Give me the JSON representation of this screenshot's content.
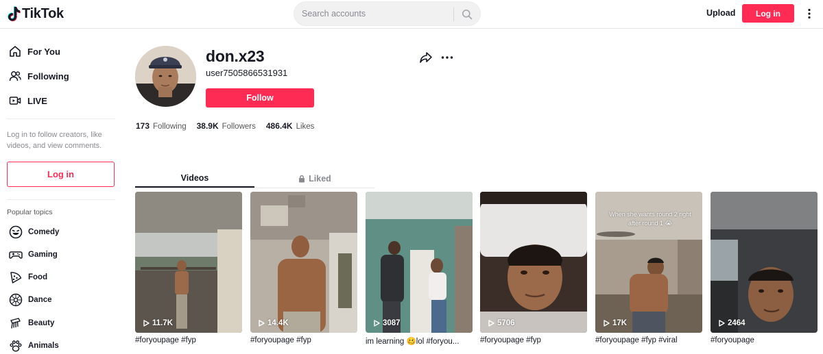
{
  "header": {
    "logo_text": "TikTok",
    "search_placeholder": "Search accounts",
    "upload_label": "Upload",
    "login_label": "Log in",
    "brand_color": "#fe2c55"
  },
  "sidebar": {
    "nav": [
      {
        "label": "For You",
        "icon": "home-icon"
      },
      {
        "label": "Following",
        "icon": "users-icon"
      },
      {
        "label": "LIVE",
        "icon": "live-icon"
      }
    ],
    "login_prompt": "Log in to follow creators, like videos, and view comments.",
    "login_label": "Log in",
    "topics_title": "Popular topics",
    "topics": [
      {
        "label": "Comedy",
        "icon": "comedy-icon"
      },
      {
        "label": "Gaming",
        "icon": "gaming-icon"
      },
      {
        "label": "Food",
        "icon": "food-icon"
      },
      {
        "label": "Dance",
        "icon": "dance-icon"
      },
      {
        "label": "Beauty",
        "icon": "beauty-icon"
      },
      {
        "label": "Animals",
        "icon": "animals-icon"
      }
    ]
  },
  "profile": {
    "username": "don.x23",
    "handle": "user7505866531931",
    "follow_label": "Follow",
    "stats": [
      {
        "value": "173",
        "label": "Following"
      },
      {
        "value": "38.9K",
        "label": "Followers"
      },
      {
        "value": "486.4K",
        "label": "Likes"
      }
    ]
  },
  "tabs": {
    "videos": "Videos",
    "liked": "Liked"
  },
  "videos": [
    {
      "plays": "11.7K",
      "caption": "#foryoupage #fyp",
      "overlay": ""
    },
    {
      "plays": "14.4K",
      "caption": "#foryoupage #fyp",
      "overlay": ""
    },
    {
      "plays": "3087",
      "caption": "im learning 🥴lol #foryou...",
      "overlay": ""
    },
    {
      "plays": "5706",
      "caption": "#foryoupage #fyp",
      "overlay": ""
    },
    {
      "plays": "17K",
      "caption": "#foryoupage #fyp #viral",
      "overlay": "When she wants round 2 right after round 1 😭"
    },
    {
      "plays": "2464",
      "caption": "#foryoupage",
      "overlay": ""
    }
  ]
}
